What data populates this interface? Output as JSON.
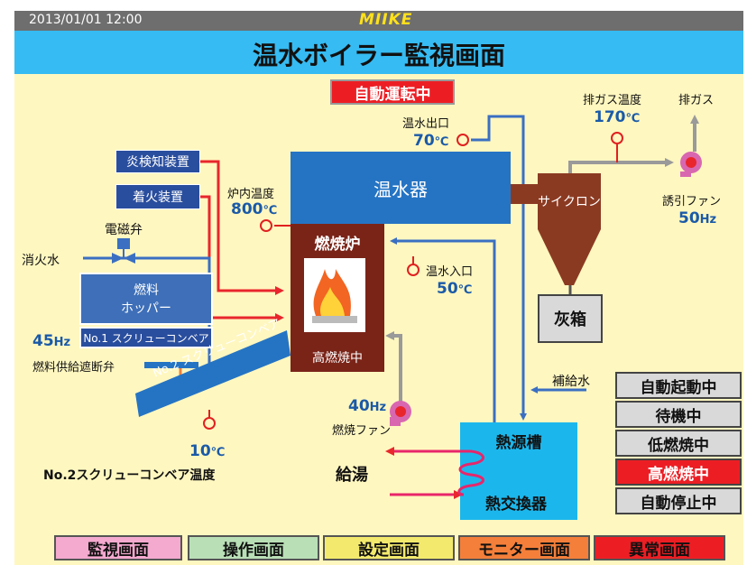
{
  "header": {
    "datetime": "2013/01/01  12:00",
    "logo": "MIIKE",
    "title": "温水ボイラー監視画面"
  },
  "mode_badge": "自動運転中",
  "devices": {
    "flame_detector": "炎検知装置",
    "igniter": "着火装置",
    "solenoid_valve": "電磁弁",
    "extinguish_water": "消火水",
    "fuel_hopper_line1": "燃料",
    "fuel_hopper_line2": "ホッパー",
    "screw_conveyor_1": "No.1 スクリューコンベア",
    "screw_conveyor_2": "No.2 スクリューコンベア",
    "fuel_cutoff_valve": "燃料供給遮断弁",
    "heater": "温水器",
    "furnace": "燃焼炉",
    "furnace_state": "高燃焼中",
    "cyclone": "サイクロン",
    "ash_box": "灰箱",
    "heat_tank": "熱源槽",
    "heat_exchanger": "熱交換器",
    "induced_fan": "誘引ファン",
    "combustion_fan": "燃焼ファン",
    "exhaust_gas": "排ガス",
    "makeup_water": "補給水",
    "hot_water_supply": "給湯"
  },
  "readings": {
    "furnace_temp": {
      "label": "炉内温度",
      "value": "800",
      "unit": "℃"
    },
    "outlet_temp": {
      "label": "温水出口",
      "value": "70",
      "unit": "℃"
    },
    "inlet_temp": {
      "label": "温水入口",
      "value": "50",
      "unit": "℃"
    },
    "exhaust_temp": {
      "label": "排ガス温度",
      "value": "170",
      "unit": "℃"
    },
    "induced_fan_freq": {
      "value": "50",
      "unit": "Hz"
    },
    "combustion_fan_freq": {
      "value": "40",
      "unit": "Hz"
    },
    "conveyor1_freq": {
      "value": "45",
      "unit": "Hz"
    },
    "conveyor2_temp": {
      "label": "No.2スクリューコンベア温度",
      "value": "10",
      "unit": "℃"
    }
  },
  "status_buttons": [
    {
      "label": "自動起動中",
      "active": false
    },
    {
      "label": "待機中",
      "active": false
    },
    {
      "label": "低燃焼中",
      "active": false
    },
    {
      "label": "高燃焼中",
      "active": true
    },
    {
      "label": "自動停止中",
      "active": false
    }
  ],
  "nav": [
    {
      "label": "監視画面",
      "color": "#f4a9cf"
    },
    {
      "label": "操作画面",
      "color": "#b9dfb6"
    },
    {
      "label": "設定画面",
      "color": "#f3ea6d"
    },
    {
      "label": "モニター画面",
      "color": "#f47f3a"
    },
    {
      "label": "異常画面",
      "color": "#ec1e24"
    }
  ],
  "colors": {
    "pipe_blue": "#3a6fc2",
    "pipe_red": "#e8262c",
    "pipe_gray": "#9a9a9a",
    "heater": "#2574c4",
    "furnace": "#7a2418",
    "cyclone": "#8b3a22",
    "tank": "#1bb7ec",
    "active_status": "#ec1e24"
  }
}
